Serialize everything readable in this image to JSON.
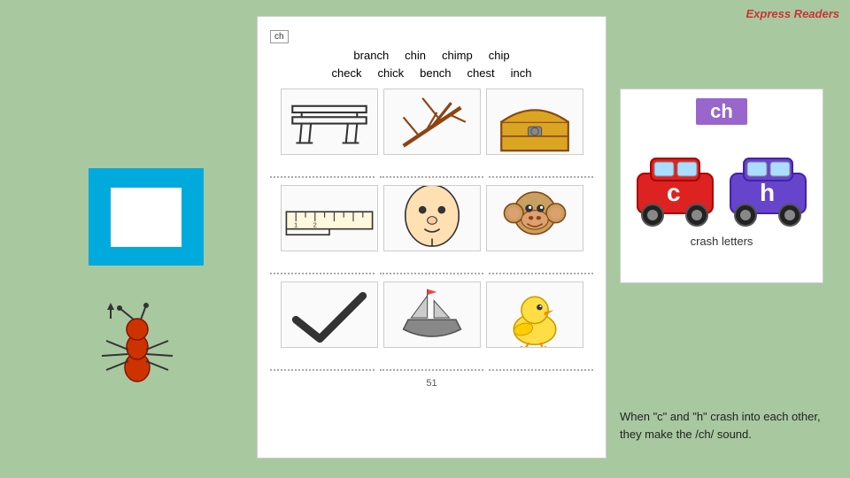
{
  "brand": "Express Readers",
  "worksheet": {
    "label": "ch",
    "word_rows": [
      [
        "branch",
        "chin",
        "chimp",
        "chip"
      ],
      [
        "check",
        "chick",
        "bench",
        "chest",
        "inch"
      ]
    ],
    "page_number": "51"
  },
  "ch_box": {
    "text": "ch"
  },
  "crash_panel": {
    "label": "ch",
    "letters_label": "crash letters"
  },
  "description": {
    "text": "When \"c\" and \"h\" crash into each other, they make the /ch/ sound."
  }
}
